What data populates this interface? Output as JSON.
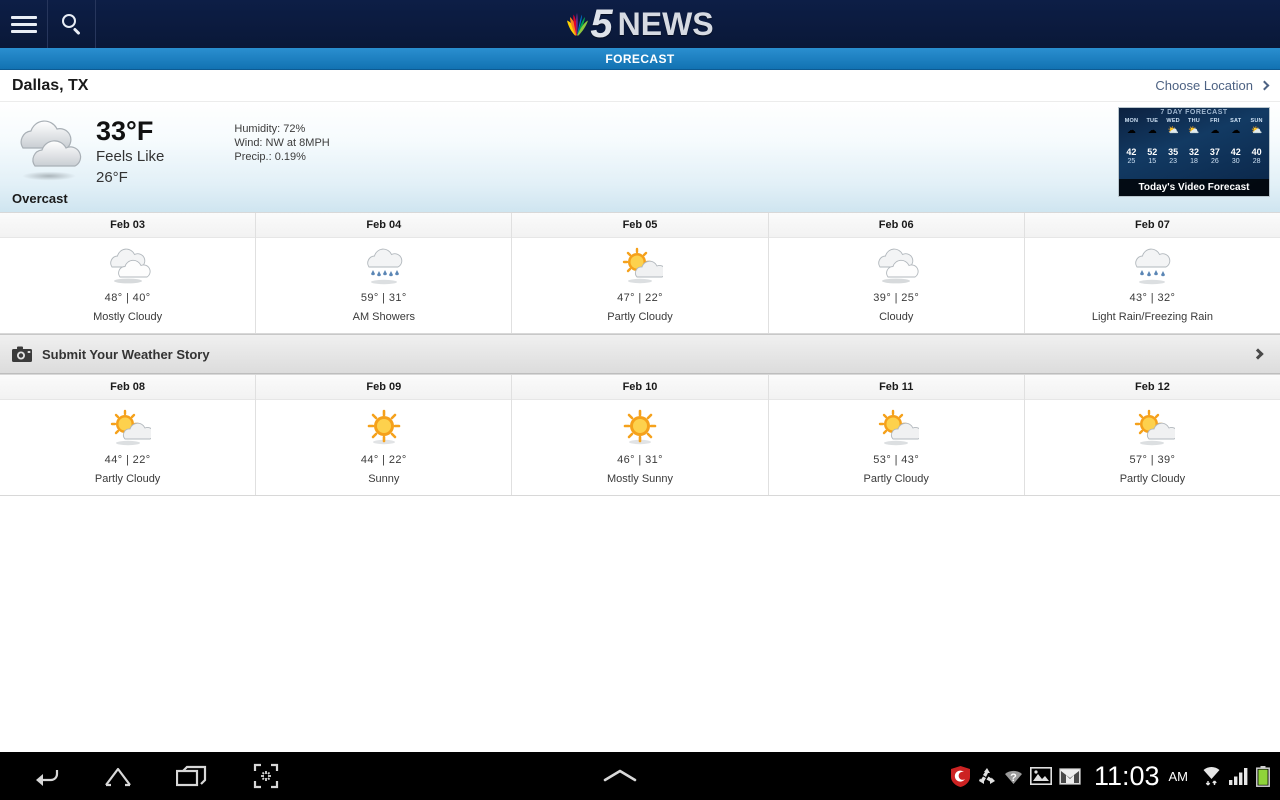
{
  "header": {
    "menu_icon": "hamburger-menu-icon",
    "search_icon": "search-icon",
    "logo_number": "5",
    "logo_word": "NEWS",
    "section_title": "FORECAST"
  },
  "location": {
    "name": "Dallas, TX",
    "choose_label": "Choose Location",
    "chevron_icon": "chevron-right-icon"
  },
  "current": {
    "icon": "cloudy-icon",
    "temperature": "33°F",
    "feels_like_label": "Feels Like",
    "feels_like_value": "26°F",
    "humidity": "Humidity: 72%",
    "wind": "Wind: NW at 8MPH",
    "precip": "Precip.: 0.19%",
    "condition": "Overcast"
  },
  "video_forecast": {
    "overlay_title": "7 DAY FORECAST",
    "caption": "Today's Video Forecast",
    "days": [
      {
        "day": "MON",
        "icon": "cloudy-icon",
        "high": "42",
        "low": "25"
      },
      {
        "day": "TUE",
        "icon": "cloudy-icon",
        "high": "52",
        "low": "15"
      },
      {
        "day": "WED",
        "icon": "partly-cloudy-icon",
        "high": "35",
        "low": "23"
      },
      {
        "day": "THU",
        "icon": "partly-cloudy-icon",
        "high": "32",
        "low": "18"
      },
      {
        "day": "FRI",
        "icon": "cloudy-icon",
        "high": "37",
        "low": "26"
      },
      {
        "day": "SAT",
        "icon": "cloudy-icon",
        "high": "42",
        "low": "30"
      },
      {
        "day": "SUN",
        "icon": "partly-cloudy-icon",
        "high": "40",
        "low": "28"
      }
    ]
  },
  "forecast_row_1": [
    {
      "date": "Feb 03",
      "icon": "cloudy-icon",
      "temps": "48° | 40°",
      "condition": "Mostly Cloudy"
    },
    {
      "date": "Feb 04",
      "icon": "rain-icon",
      "temps": "59° | 31°",
      "condition": "AM Showers"
    },
    {
      "date": "Feb 05",
      "icon": "partly-cloudy-icon",
      "temps": "47° | 22°",
      "condition": "Partly Cloudy"
    },
    {
      "date": "Feb 06",
      "icon": "cloudy-icon",
      "temps": "39° | 25°",
      "condition": "Cloudy"
    },
    {
      "date": "Feb 07",
      "icon": "rain-icon",
      "temps": "43° | 32°",
      "condition": "Light Rain/Freezing Rain"
    }
  ],
  "submit_bar": {
    "camera_icon": "camera-icon",
    "label": "Submit Your Weather Story",
    "chevron_icon": "chevron-right-icon"
  },
  "forecast_row_2": [
    {
      "date": "Feb 08",
      "icon": "partly-cloudy-icon",
      "temps": "44° | 22°",
      "condition": "Partly Cloudy"
    },
    {
      "date": "Feb 09",
      "icon": "sunny-icon",
      "temps": "44° | 22°",
      "condition": "Sunny"
    },
    {
      "date": "Feb 10",
      "icon": "sunny-icon",
      "temps": "46° | 31°",
      "condition": "Mostly Sunny"
    },
    {
      "date": "Feb 11",
      "icon": "partly-cloudy-icon",
      "temps": "53° | 43°",
      "condition": "Partly Cloudy"
    },
    {
      "date": "Feb 12",
      "icon": "partly-cloudy-icon",
      "temps": "57° | 39°",
      "condition": "Partly Cloudy"
    }
  ],
  "system_bar": {
    "nav": [
      "back-icon",
      "home-icon",
      "recents-icon",
      "screenshot-icon"
    ],
    "expand_icon": "chevron-up-icon",
    "status_icons": [
      "security-shield-icon",
      "recycle-icon",
      "wifi-help-icon",
      "gallery-icon",
      "gmail-icon"
    ],
    "clock": "11:03",
    "ampm": "AM",
    "connection_icons": [
      "wifi-icon",
      "signal-bars-icon",
      "battery-icon"
    ]
  },
  "colors": {
    "header_navy": "#0b1b3f",
    "banner_blue": "#1b7fc4",
    "link_blue": "#4d6283",
    "sun_orange": "#f5a11b",
    "battery_green": "#8fd43a"
  }
}
